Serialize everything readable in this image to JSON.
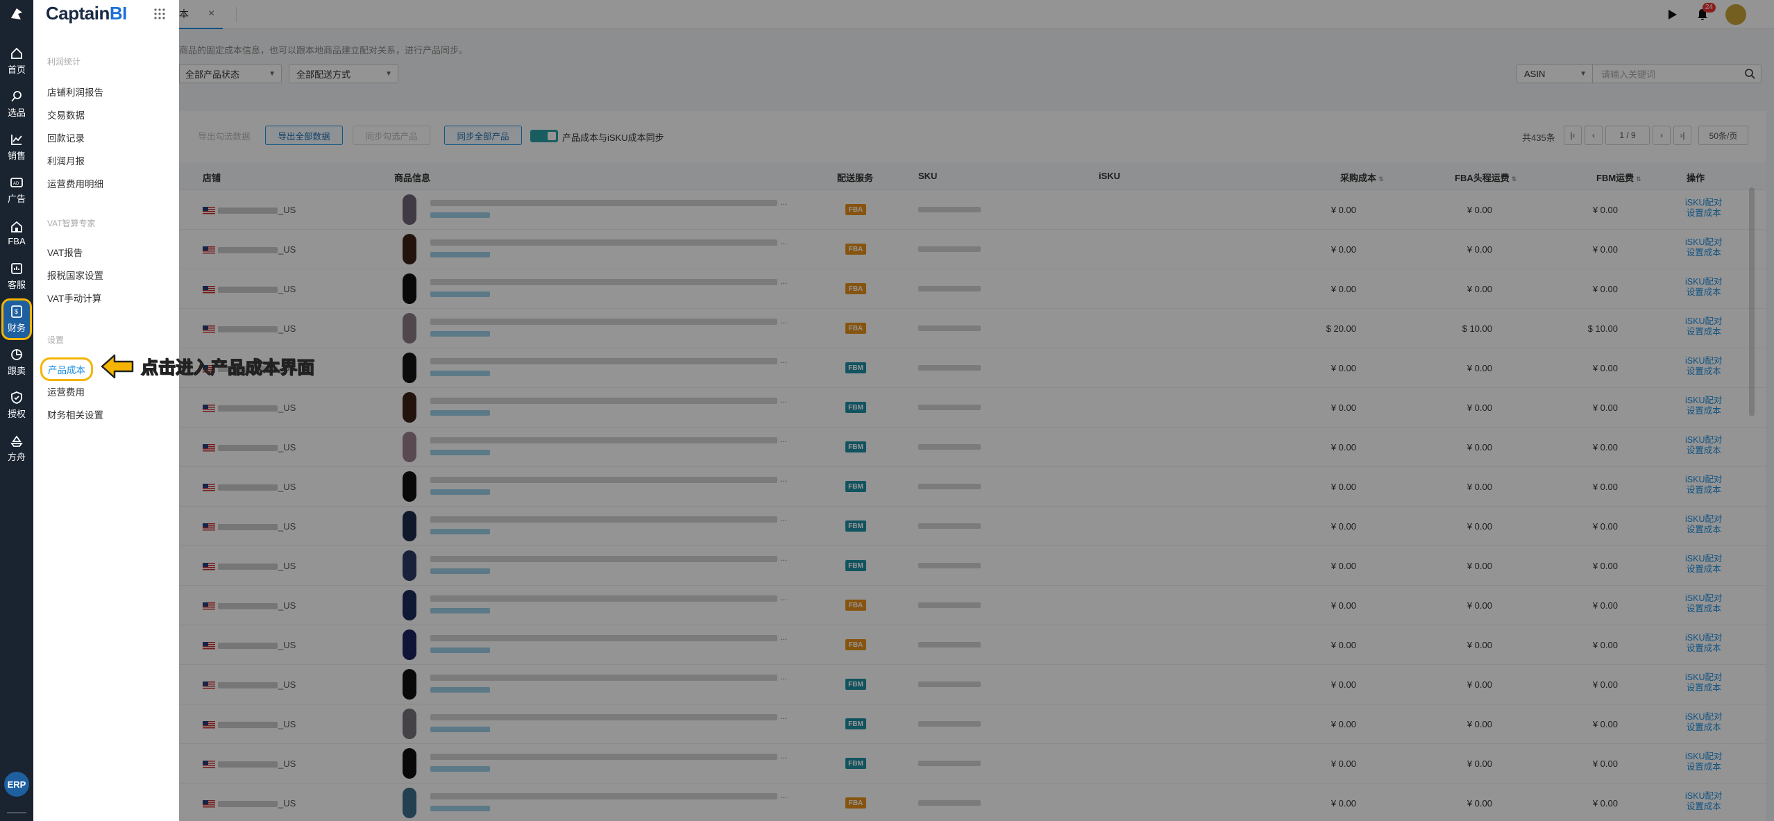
{
  "rail": {
    "items": [
      {
        "label": "首页",
        "icon": "home-icon"
      },
      {
        "label": "选品",
        "icon": "search-icon"
      },
      {
        "label": "销售",
        "icon": "chart-icon"
      },
      {
        "label": "广告",
        "icon": "ad-icon"
      },
      {
        "label": "FBA",
        "icon": "house-icon"
      },
      {
        "label": "客服",
        "icon": "service-icon"
      },
      {
        "label": "财务",
        "icon": "finance-icon",
        "active": true
      },
      {
        "label": "跟卖",
        "icon": "pie-icon"
      },
      {
        "label": "授权",
        "icon": "shield-icon"
      },
      {
        "label": "方舟",
        "icon": "ark-icon"
      }
    ],
    "erp": "ERP"
  },
  "submenu": {
    "brand": "Captain",
    "brand_suffix": "BI",
    "sections": [
      {
        "title": "利润统计",
        "items": [
          "店铺利润报告",
          "交易数据",
          "回款记录",
          "利润月报",
          "运营费用明细"
        ]
      },
      {
        "title": "VAT智算专家",
        "items": [
          "VAT报告",
          "报税国家设置",
          "VAT手动计算"
        ]
      },
      {
        "title": "设置",
        "items": [
          "产品成本",
          "运营费用",
          "财务相关设置"
        ]
      }
    ],
    "active_item": "产品成本"
  },
  "annotation": {
    "text": "点击进入产品成本界面",
    "color": "#f5b400"
  },
  "topbar": {
    "tab_label": "本",
    "notification_count": "24"
  },
  "page": {
    "description": "商品的固定成本信息，也可以跟本地商品建立配对关系，进行产品同步。",
    "filters": {
      "status": "全部产品状态",
      "shipping": "全部配送方式",
      "field": "ASIN",
      "search_placeholder": "请输入关键词"
    },
    "toolbar": {
      "export_checked": "导出勾选数据",
      "export_all": "导出全部数据",
      "sync_checked": "同步勾选产品",
      "sync_all": "同步全部产品",
      "sync_toggle_label": "产品成本与iSKU成本同步"
    },
    "pagination": {
      "total": "共435条",
      "page": "1",
      "pages": "/ 9",
      "per_page": "50条/页"
    },
    "columns": {
      "store": "店铺",
      "product": "商品信息",
      "service": "配送服务",
      "sku": "SKU",
      "isku": "iSKU",
      "purchase_cost": "采购成本",
      "fba_freight": "FBA头程运费",
      "fbm_freight": "FBM运费",
      "ops": "操作"
    },
    "rows": [
      {
        "store": "_US",
        "service": "FBA",
        "purchase": "¥ 0.00",
        "fba": "¥ 0.00",
        "fbm": "¥ 0.00",
        "thumb": "#6e6478"
      },
      {
        "store": "_US",
        "service": "FBA",
        "purchase": "¥ 0.00",
        "fba": "¥ 0.00",
        "fbm": "¥ 0.00",
        "thumb": "#3b2418"
      },
      {
        "store": "_US",
        "service": "FBA",
        "purchase": "¥ 0.00",
        "fba": "¥ 0.00",
        "fbm": "¥ 0.00",
        "thumb": "#111111"
      },
      {
        "store": "_US",
        "service": "FBA",
        "purchase": "$ 20.00",
        "fba": "$ 10.00",
        "fbm": "$ 10.00",
        "thumb": "#8a7a86"
      },
      {
        "store": "_US",
        "service": "FBM",
        "purchase": "¥ 0.00",
        "fba": "¥ 0.00",
        "fbm": "¥ 0.00",
        "thumb": "#141414"
      },
      {
        "store": "_US",
        "service": "FBM",
        "purchase": "¥ 0.00",
        "fba": "¥ 0.00",
        "fbm": "¥ 0.00",
        "thumb": "#3b2418"
      },
      {
        "store": "_US",
        "service": "FBM",
        "purchase": "¥ 0.00",
        "fba": "¥ 0.00",
        "fbm": "¥ 0.00",
        "thumb": "#9a7f8c"
      },
      {
        "store": "_US",
        "service": "FBM",
        "purchase": "¥ 0.00",
        "fba": "¥ 0.00",
        "fbm": "¥ 0.00",
        "thumb": "#111111"
      },
      {
        "store": "_US",
        "service": "FBM",
        "purchase": "¥ 0.00",
        "fba": "¥ 0.00",
        "fbm": "¥ 0.00",
        "thumb": "#1c2a4c"
      },
      {
        "store": "_US",
        "service": "FBM",
        "purchase": "¥ 0.00",
        "fba": "¥ 0.00",
        "fbm": "¥ 0.00",
        "thumb": "#2b3a66"
      },
      {
        "store": "_US",
        "service": "FBA",
        "purchase": "¥ 0.00",
        "fba": "¥ 0.00",
        "fbm": "¥ 0.00",
        "thumb": "#1a2c5a"
      },
      {
        "store": "_US",
        "service": "FBA",
        "purchase": "¥ 0.00",
        "fba": "¥ 0.00",
        "fbm": "¥ 0.00",
        "thumb": "#1c2560"
      },
      {
        "store": "_US",
        "service": "FBM",
        "purchase": "¥ 0.00",
        "fba": "¥ 0.00",
        "fbm": "¥ 0.00",
        "thumb": "#111111"
      },
      {
        "store": "_US",
        "service": "FBM",
        "purchase": "¥ 0.00",
        "fba": "¥ 0.00",
        "fbm": "¥ 0.00",
        "thumb": "#75707a"
      },
      {
        "store": "_US",
        "service": "FBM",
        "purchase": "¥ 0.00",
        "fba": "¥ 0.00",
        "fbm": "¥ 0.00",
        "thumb": "#111111"
      },
      {
        "store": "_US",
        "service": "FBA",
        "purchase": "¥ 0.00",
        "fba": "¥ 0.00",
        "fbm": "¥ 0.00",
        "thumb": "#3d6e8a"
      }
    ],
    "row_actions": [
      "iSKU配对",
      "设置成本"
    ]
  }
}
